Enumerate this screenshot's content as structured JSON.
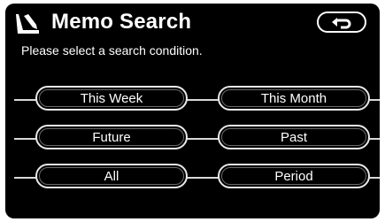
{
  "header": {
    "title": "Memo Search",
    "subtitle": "Please select a search condition.",
    "icon": "memo-pen-icon",
    "back_icon": "back-arrow-icon"
  },
  "options": [
    {
      "label": "This Week"
    },
    {
      "label": "This Month"
    },
    {
      "label": "Future"
    },
    {
      "label": "Past"
    },
    {
      "label": "All"
    },
    {
      "label": "Period"
    }
  ],
  "colors": {
    "background": "#000000",
    "text": "#ffffff",
    "button_border": "#e8e8e8"
  }
}
